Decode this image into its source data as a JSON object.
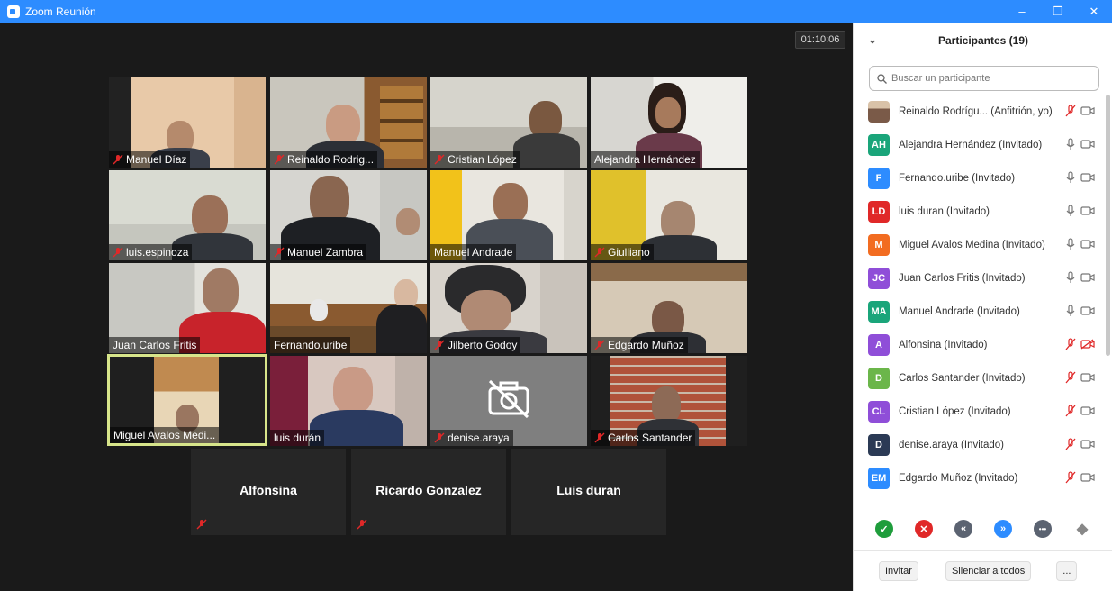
{
  "window": {
    "title": "Zoom Reunión",
    "controls": [
      "–",
      "❐",
      "✕"
    ]
  },
  "meeting": {
    "timer": "01:10:06"
  },
  "video_tiles": [
    {
      "name": "Manuel Díaz",
      "muted": true
    },
    {
      "name": "Reinaldo Rodrig...",
      "muted": true
    },
    {
      "name": "Cristian López",
      "muted": true
    },
    {
      "name": "Alejandra Hernández",
      "muted": false
    },
    {
      "name": "luis.espinoza",
      "muted": true
    },
    {
      "name": "Manuel Zambra",
      "muted": true
    },
    {
      "name": "Manuel Andrade",
      "muted": false
    },
    {
      "name": "Giulliano",
      "muted": true
    },
    {
      "name": "Juan Carlos Fritis",
      "muted": false
    },
    {
      "name": "Fernando.uribe",
      "muted": false
    },
    {
      "name": "Jilberto Godoy",
      "muted": true
    },
    {
      "name": "Edgardo Muñoz",
      "muted": true
    },
    {
      "name": "Miguel Avalos Medi...",
      "muted": false
    },
    {
      "name": "luis durán",
      "muted": false
    },
    {
      "name": "denise.araya",
      "muted": true
    },
    {
      "name": "Carlos Santander",
      "muted": true
    }
  ],
  "name_tiles": [
    {
      "name": "Alfonsina"
    },
    {
      "name": "Ricardo Gonzalez"
    },
    {
      "name": "Luis duran"
    }
  ],
  "panel": {
    "title": "Participantes (19)",
    "search_placeholder": "Buscar un participante",
    "participants": [
      {
        "initials": "",
        "name": "Reinaldo Rodrígu...  (Anfitrión, yo)",
        "color": "#7a5a48",
        "mic": "off",
        "cam": "on"
      },
      {
        "initials": "AH",
        "name": "Alejandra Hernández (Invitado)",
        "color": "#1aa57a",
        "mic": "on",
        "cam": "on"
      },
      {
        "initials": "F",
        "name": "Fernando.uribe (Invitado)",
        "color": "#2d8cff",
        "mic": "on",
        "cam": "on"
      },
      {
        "initials": "LD",
        "name": "luis duran (Invitado)",
        "color": "#e02828",
        "mic": "on",
        "cam": "on"
      },
      {
        "initials": "M",
        "name": "Miguel Avalos Medina (Invitado)",
        "color": "#f26c21",
        "mic": "on",
        "cam": "on"
      },
      {
        "initials": "JC",
        "name": "Juan Carlos Fritis  (Invitado)",
        "color": "#8f4ed8",
        "mic": "on",
        "cam": "on"
      },
      {
        "initials": "MA",
        "name": "Manuel Andrade (Invitado)",
        "color": "#1aa57a",
        "mic": "on",
        "cam": "on"
      },
      {
        "initials": "A",
        "name": "Alfonsina (Invitado)",
        "color": "#8f4ed8",
        "mic": "off",
        "cam": "off"
      },
      {
        "initials": "D",
        "name": "Carlos Santander (Invitado)",
        "color": "#6bb64a",
        "mic": "off",
        "cam": "on"
      },
      {
        "initials": "CL",
        "name": "Cristian López (Invitado)",
        "color": "#8f4ed8",
        "mic": "off",
        "cam": "on"
      },
      {
        "initials": "D",
        "name": "denise.araya (Invitado)",
        "color": "#2b3a55",
        "mic": "off",
        "cam": "on"
      },
      {
        "initials": "EM",
        "name": "Edgardo Muñoz (Invitado)",
        "color": "#2d8cff",
        "mic": "off",
        "cam": "on"
      }
    ],
    "reactions": [
      {
        "icon": "check-icon",
        "glyph": "✓",
        "color": "#1f9d3c"
      },
      {
        "icon": "x-icon",
        "glyph": "✕",
        "color": "#e02828"
      },
      {
        "icon": "slower-icon",
        "glyph": "«",
        "color": "#5b6371"
      },
      {
        "icon": "faster-icon",
        "glyph": "»",
        "color": "#2d8cff"
      },
      {
        "icon": "more-icon",
        "glyph": "•••",
        "color": "#5b6371"
      },
      {
        "icon": "clear-icon",
        "glyph": "◆",
        "color": "#888888"
      }
    ],
    "footer": {
      "invite": "Invitar",
      "mute_all": "Silenciar a todos",
      "more": "..."
    }
  }
}
